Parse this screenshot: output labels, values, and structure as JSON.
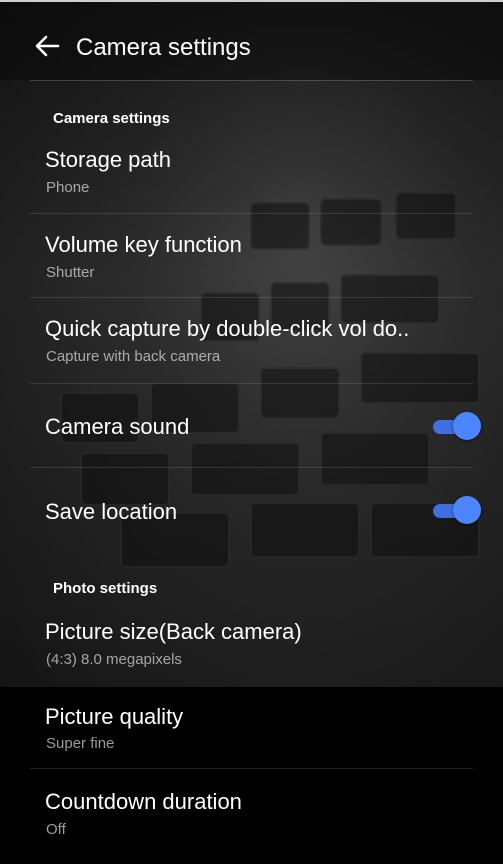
{
  "colors": {
    "accent": "#4b85ff",
    "background": "#000000"
  },
  "header": {
    "title": "Camera settings",
    "back_icon": "arrow-left-icon"
  },
  "sections": {
    "camera": "Camera settings",
    "photo": "Photo settings"
  },
  "items": {
    "storage": {
      "label": "Storage path",
      "value": "Phone"
    },
    "volume": {
      "label": "Volume key function",
      "value": "Shutter"
    },
    "quick": {
      "label": "Quick capture by double-click vol do..",
      "value": "Capture with back camera"
    },
    "sound": {
      "label": "Camera sound",
      "enabled": true
    },
    "location": {
      "label": "Save location",
      "enabled": true
    },
    "picsize": {
      "label": "Picture size(Back camera)",
      "value": "(4:3) 8.0 megapixels"
    },
    "quality": {
      "label": "Picture quality",
      "value": "Super fine"
    },
    "countdown": {
      "label": "Countdown duration",
      "value": "Off"
    }
  }
}
